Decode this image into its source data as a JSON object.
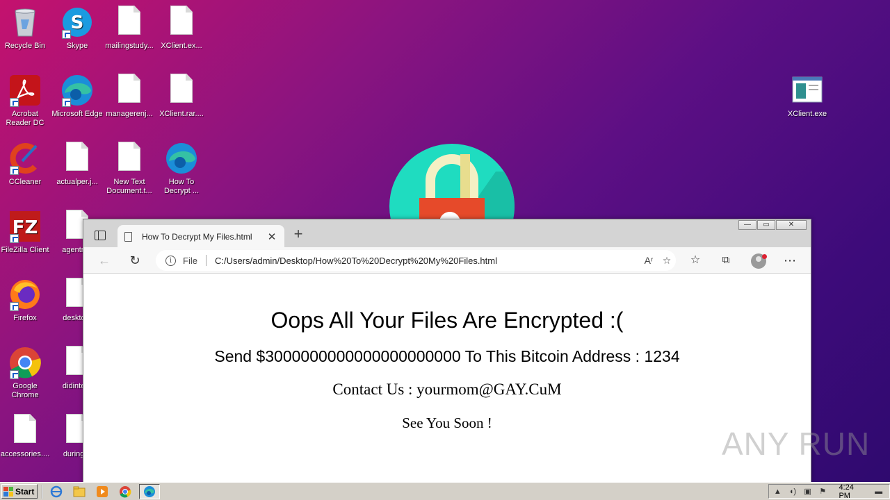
{
  "desktop": {
    "icons": [
      {
        "label": "Recycle Bin"
      },
      {
        "label": "Skype"
      },
      {
        "label": "mailingstudy..."
      },
      {
        "label": "XClient.ex..."
      },
      {
        "label": "Acrobat Reader DC"
      },
      {
        "label": "Microsoft Edge"
      },
      {
        "label": "managerenj..."
      },
      {
        "label": "XClient.rar...."
      },
      {
        "label": "CCleaner"
      },
      {
        "label": "actualper.j..."
      },
      {
        "label": "New Text Document.t..."
      },
      {
        "label": "How To Decrypt ..."
      },
      {
        "label": "FileZilla Client"
      },
      {
        "label": "agentred"
      },
      {
        "label": "Firefox"
      },
      {
        "label": "desktop."
      },
      {
        "label": "Google Chrome"
      },
      {
        "label": "didintere"
      },
      {
        "label": "accessories...."
      },
      {
        "label": "duringer"
      },
      {
        "label": "XClient.exe"
      }
    ]
  },
  "browser": {
    "tab_title": "How To Decrypt My Files.html",
    "tab_close": "✕",
    "new_tab": "+",
    "address_file_label": "File",
    "url": "C:/Users/admin/Desktop/How%20To%20Decrypt%20My%20Files.html",
    "window_controls": [
      "—",
      "▭",
      "✕"
    ]
  },
  "page": {
    "heading": "Oops All Your Files Are Encrypted :(",
    "send_line": "Send $3000000000000000000000 To This Bitcoin Address : 1234",
    "contact_line": "Contact Us : yourmom@GAY.CuM",
    "soon_line": "See You Soon !"
  },
  "watermark": "ANY RUN",
  "taskbar": {
    "start_label": "Start",
    "clock": "4:24 PM"
  },
  "colors": {
    "desktop_gradient_start": "#c4126e",
    "desktop_gradient_end": "#2e0a6e",
    "lock_circle": "#1fdcc0",
    "lock_body": "#e64a2a"
  }
}
